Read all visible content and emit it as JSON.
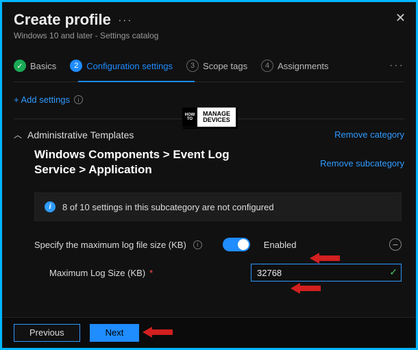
{
  "header": {
    "title": "Create profile",
    "subtitle": "Windows 10 and later - Settings catalog"
  },
  "wizard": {
    "steps": [
      {
        "num": "",
        "label": "Basics"
      },
      {
        "num": "2",
        "label": "Configuration settings"
      },
      {
        "num": "3",
        "label": "Scope tags"
      },
      {
        "num": "4",
        "label": "Assignments"
      }
    ]
  },
  "actions": {
    "add_settings": "+ Add settings"
  },
  "category": {
    "title": "Administrative Templates",
    "remove": "Remove category",
    "breadcrumb": "Windows Components > Event Log Service > Application",
    "remove_sub": "Remove subcategory"
  },
  "banner": {
    "text": "8 of 10 settings in this subcategory are not configured"
  },
  "setting": {
    "label": "Specify the maximum log file size (KB)",
    "toggle_label": "Enabled",
    "field_label": "Maximum Log Size (KB)",
    "field_value": "32768"
  },
  "footer": {
    "previous": "Previous",
    "next": "Next"
  },
  "logo": {
    "l1": "HOW",
    "l2": "TO",
    "r1": "MANAGE",
    "r2": "DEVICES"
  }
}
